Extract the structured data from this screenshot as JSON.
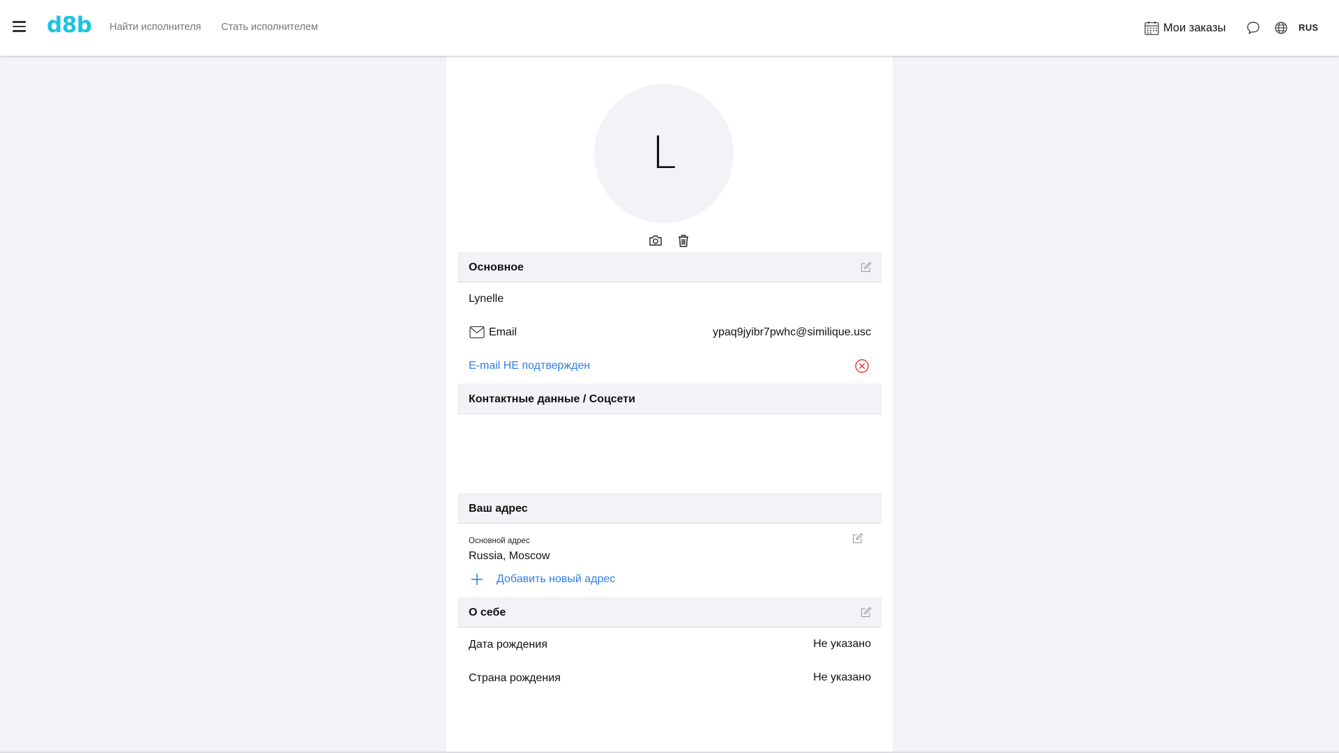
{
  "header": {
    "logo": "d8b",
    "nav": [
      {
        "label": "Найти исполнителя"
      },
      {
        "label": "Стать исполнителем"
      }
    ],
    "orders_label": "Мои заказы",
    "lang": "RUS",
    "icons": [
      "menu-icon",
      "calendar-icon",
      "chat-icon",
      "globe-icon"
    ]
  },
  "profile": {
    "avatar_letter": "L",
    "avatar_tools": [
      "camera-icon",
      "trash-icon"
    ]
  },
  "sections": {
    "main": {
      "title": "Основное",
      "name": "Lynelle",
      "email_label": "Email",
      "email_value": "ypaq9jyibr7pwhc@similique.usc",
      "email_status": "E-mail НЕ подтвержден"
    },
    "contacts": {
      "title": "Контактные данные / Соцсети"
    },
    "address": {
      "title": "Ваш адрес",
      "primary_label": "Основной адрес",
      "primary_value": "Russia, Moscow",
      "add_label": "Добавить новый адрес"
    },
    "about": {
      "title": "О себе",
      "rows": [
        {
          "label": "Дата рождения",
          "value": "Не указано"
        },
        {
          "label": "Страна рождения",
          "value": "Не указано"
        }
      ]
    }
  },
  "colors": {
    "brand": "#1ec2e0",
    "link": "#2f7fe3",
    "error": "#e53935",
    "page_bg": "#f2f3f7"
  }
}
